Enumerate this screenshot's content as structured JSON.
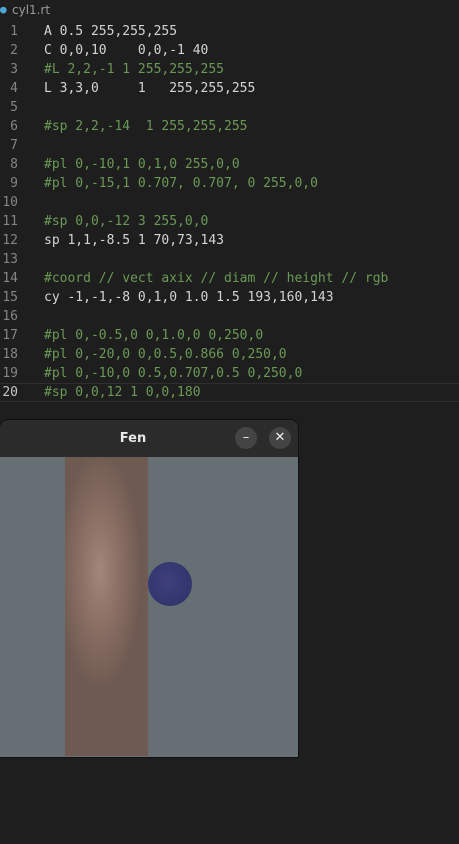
{
  "editor": {
    "tab_icon": "●",
    "filename": "cyl1.rt",
    "lines": [
      {
        "num": "1",
        "text": "A 0.5 255,255,255"
      },
      {
        "num": "2",
        "text": "C 0,0,10    0,0,-1 40"
      },
      {
        "num": "3",
        "text": "#L 2,2,-1 1 255,255,255"
      },
      {
        "num": "4",
        "text": "L 3,3,0     1   255,255,255"
      },
      {
        "num": "5",
        "text": ""
      },
      {
        "num": "6",
        "text": "#sp 2,2,-14  1 255,255,255"
      },
      {
        "num": "7",
        "text": ""
      },
      {
        "num": "8",
        "text": "#pl 0,-10,1 0,1,0 255,0,0"
      },
      {
        "num": "9",
        "text": "#pl 0,-15,1 0.707, 0.707, 0 255,0,0"
      },
      {
        "num": "10",
        "text": ""
      },
      {
        "num": "11",
        "text": "#sp 0,0,-12 3 255,0,0"
      },
      {
        "num": "12",
        "text": "sp 1,1,-8.5 1 70,73,143"
      },
      {
        "num": "13",
        "text": ""
      },
      {
        "num": "14",
        "text": "#coord // vect axix // diam // height // rgb"
      },
      {
        "num": "15",
        "text": "cy -1,-1,-8 0,1,0 1.0 1.5 193,160,143"
      },
      {
        "num": "16",
        "text": ""
      },
      {
        "num": "17",
        "text": "#pl 0,-0.5,0 0,1.0,0 0,250,0"
      },
      {
        "num": "18",
        "text": "#pl 0,-20,0 0,0.5,0.866 0,250,0"
      },
      {
        "num": "19",
        "text": "#pl 0,-10,0 0.5,0.707,0.5 0,250,0"
      },
      {
        "num": "20",
        "text": "#sp 0,0,12 1 0,0,180"
      }
    ]
  },
  "window": {
    "title": "Fen",
    "minimize_glyph": "–",
    "close_glyph": "✕"
  },
  "colors": {
    "editor_bg": "#1e1e1e",
    "comment": "#6a9955",
    "code_text": "#d4d4d4",
    "render_bg": "#656f74",
    "cylinder": "#8c7065",
    "sphere": "#33356d"
  }
}
